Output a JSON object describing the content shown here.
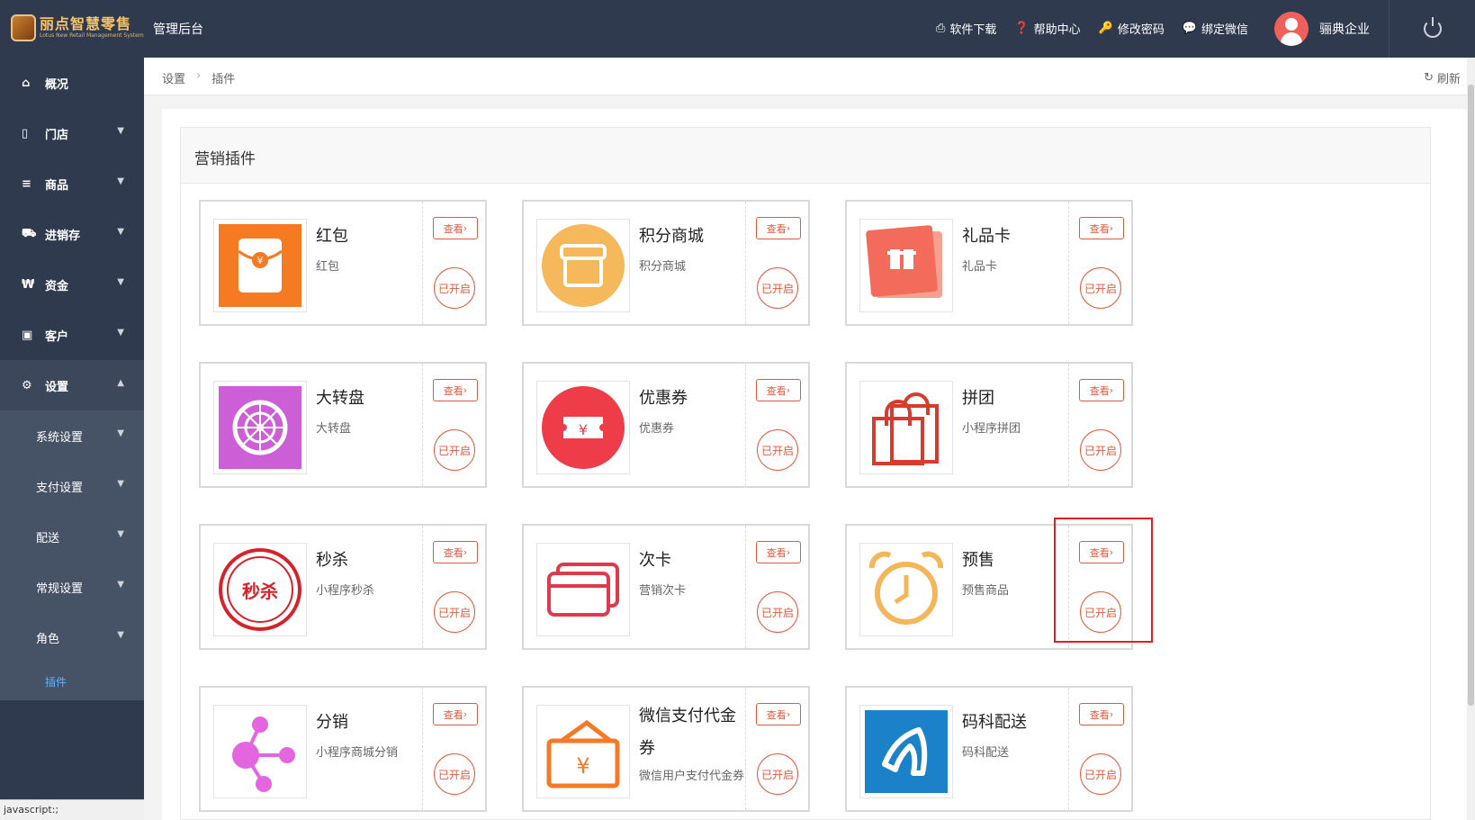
{
  "header": {
    "logo_text": "丽点智慧零售",
    "logo_subtext": "Lotus New Retail Management System",
    "admin_title": "管理后台",
    "actions": [
      {
        "label": "软件下载",
        "icon": "download-icon",
        "glyph": "⎙"
      },
      {
        "label": "帮助中心",
        "icon": "help-icon",
        "glyph": "❓"
      },
      {
        "label": "修改密码",
        "icon": "key-icon",
        "glyph": "🔑"
      },
      {
        "label": "绑定微信",
        "icon": "wechat-icon",
        "glyph": "💬"
      }
    ],
    "username": "骊典企业"
  },
  "sidebar": {
    "items": [
      {
        "label": "概况",
        "glyph": "⌂"
      },
      {
        "label": "门店",
        "glyph": "▯"
      },
      {
        "label": "商品",
        "glyph": "≡"
      },
      {
        "label": "进销存",
        "glyph": "⛟"
      },
      {
        "label": "资金",
        "glyph": "₩"
      },
      {
        "label": "客户",
        "glyph": "▣"
      },
      {
        "label": "设置",
        "glyph": "⚙"
      }
    ],
    "sub_items": [
      {
        "label": "系统设置"
      },
      {
        "label": "支付设置"
      },
      {
        "label": "配送"
      },
      {
        "label": "常规设置"
      },
      {
        "label": "角色"
      }
    ],
    "active_leaf": "插件"
  },
  "breadcrumb": {
    "items": [
      "设置",
      "插件"
    ],
    "refresh_label": "刷新"
  },
  "panel": {
    "title": "营销插件"
  },
  "cards": [
    {
      "title": "红包",
      "desc": "红包",
      "view": "查看",
      "status": "已开启",
      "icon": "red-packet-icon"
    },
    {
      "title": "积分商城",
      "desc": "积分商城",
      "view": "查看",
      "status": "已开启",
      "icon": "store-icon"
    },
    {
      "title": "礼品卡",
      "desc": "礼品卡",
      "view": "查看",
      "status": "已开启",
      "icon": "gift-card-icon"
    },
    {
      "title": "大转盘",
      "desc": "大转盘",
      "view": "查看",
      "status": "已开启",
      "icon": "wheel-icon"
    },
    {
      "title": "优惠券",
      "desc": "优惠券",
      "view": "查看",
      "status": "已开启",
      "icon": "coupon-icon"
    },
    {
      "title": "拼团",
      "desc": "小程序拼团",
      "view": "查看",
      "status": "已开启",
      "icon": "shopping-bag-icon"
    },
    {
      "title": "秒杀",
      "desc": "小程序秒杀",
      "view": "查看",
      "status": "已开启",
      "icon": "flash-sale-icon"
    },
    {
      "title": "次卡",
      "desc": "营销次卡",
      "view": "查看",
      "status": "已开启",
      "icon": "cards-icon"
    },
    {
      "title": "预售",
      "desc": "预售商品",
      "view": "查看",
      "status": "已开启",
      "icon": "alarm-clock-icon"
    },
    {
      "title": "分销",
      "desc": "小程序商城分销",
      "view": "查看",
      "status": "已开启",
      "icon": "share-nodes-icon"
    },
    {
      "title": "微信支付代金券",
      "desc": "微信用户支付代金券",
      "view": "查看",
      "status": "已开启",
      "icon": "wallet-icon"
    },
    {
      "title": "码科配送",
      "desc": "码科配送",
      "view": "查看",
      "status": "已开启",
      "icon": "delivery-horse-icon"
    }
  ],
  "status_bar": "javascript:;"
}
